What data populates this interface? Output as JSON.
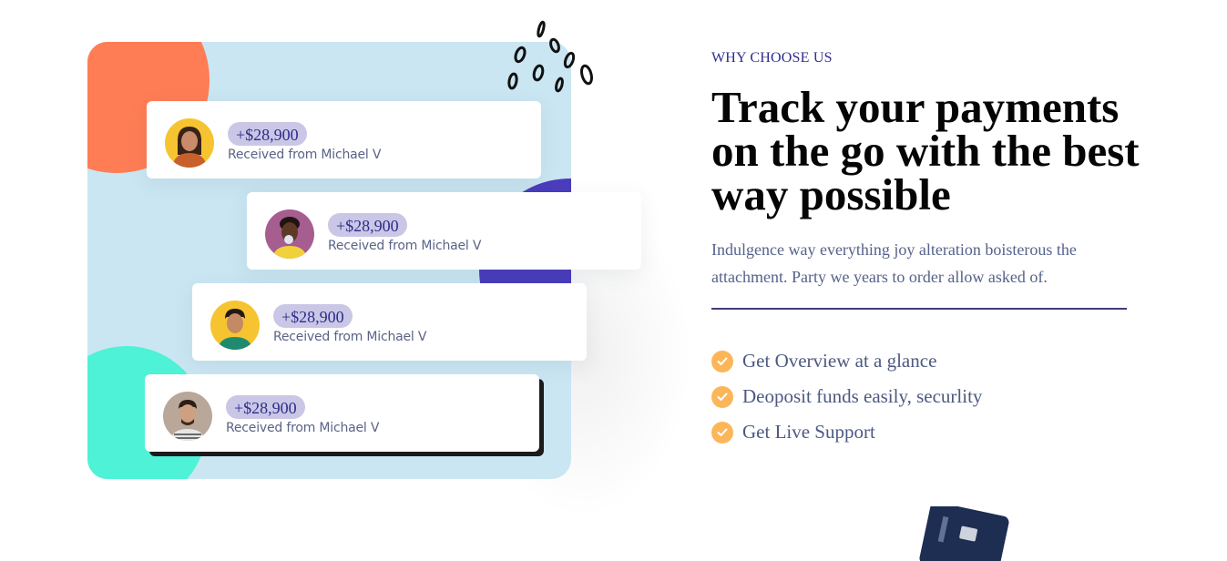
{
  "section": {
    "eyebrow": "WHY CHOOSE US",
    "headline": "Track your payments on the go with the best way possible",
    "description": "Indulgence way everything joy alteration boisterous the attachment. Party we years to order allow asked of."
  },
  "features": [
    {
      "label": "Get Overview at a glance",
      "icon": "check-icon"
    },
    {
      "label": "Deoposit funds easily, securlity",
      "icon": "check-icon"
    },
    {
      "label": "Get Live Support",
      "icon": "check-icon"
    }
  ],
  "payments": [
    {
      "amount": "+$28,900",
      "caption": "Received from Michael V",
      "avatar": "avatar-woman-smiling"
    },
    {
      "amount": "+$28,900",
      "caption": "Received from Michael V",
      "avatar": "avatar-woman-bubblegum"
    },
    {
      "amount": "+$28,900",
      "caption": "Received from Michael V",
      "avatar": "avatar-man-yellow"
    },
    {
      "amount": "+$28,900",
      "caption": "Received from Michael V",
      "avatar": "avatar-man-beard"
    }
  ],
  "colors": {
    "accent": "#2f2c8f",
    "check": "#fcb65a",
    "panel": "#cae6f2",
    "blob_orange": "#ff7d55",
    "blob_purple": "#4b3dbd",
    "blob_mint": "#4ef2d6"
  }
}
